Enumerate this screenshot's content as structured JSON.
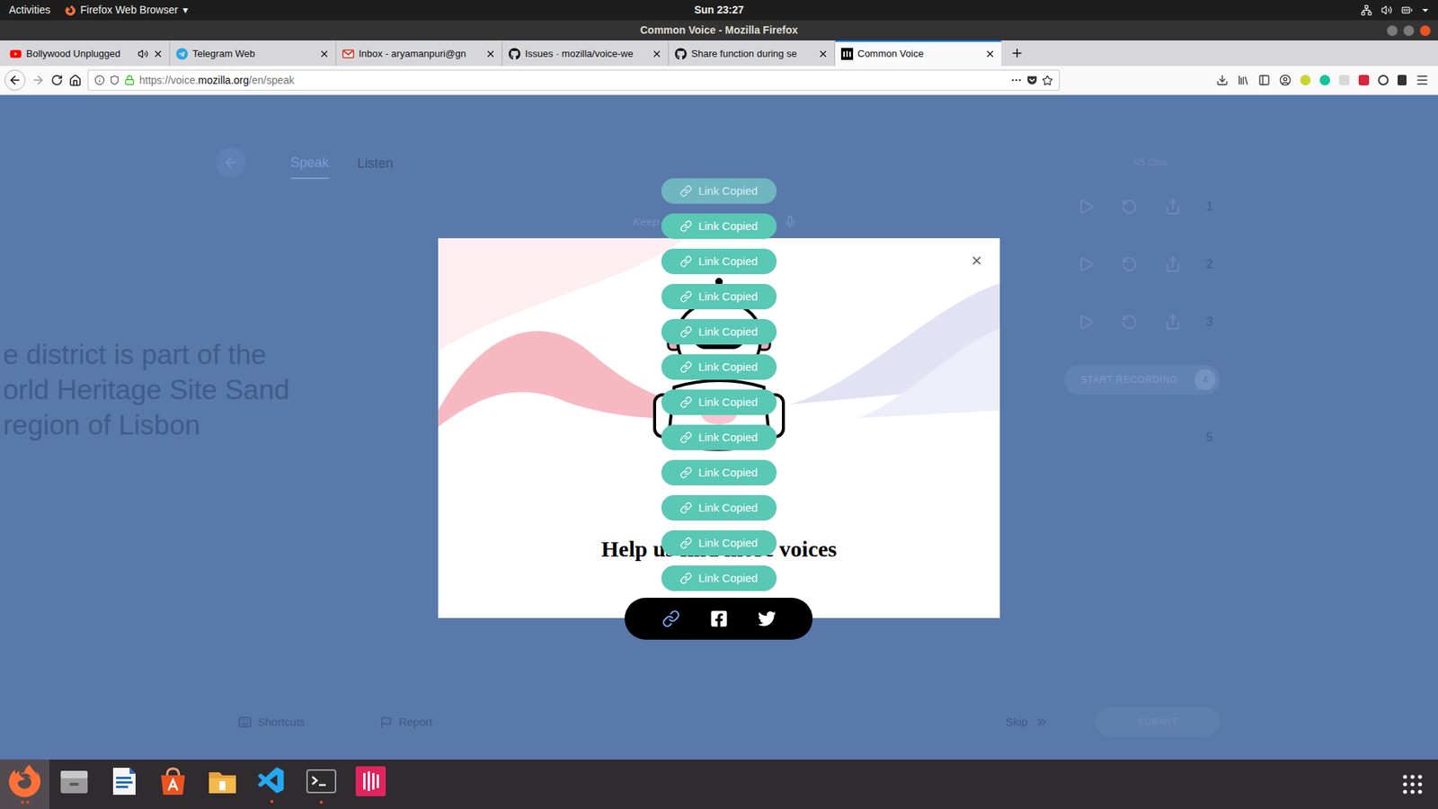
{
  "topbar": {
    "activities": "Activities",
    "app": "Firefox Web Browser",
    "app_arrow": "▾",
    "clock": "Sun 23:27"
  },
  "window": {
    "title": "Common Voice - Mozilla Firefox"
  },
  "tabs": [
    {
      "label": "Bollywood Unplugged",
      "selected": false,
      "playing_audio": true,
      "kind": "youtube"
    },
    {
      "label": "Telegram Web",
      "selected": false,
      "playing_audio": false,
      "kind": "telegram"
    },
    {
      "label": "Inbox - aryamanpuri@gn",
      "selected": false,
      "playing_audio": false,
      "kind": "gmail"
    },
    {
      "label": "Issues · mozilla/voice-we",
      "selected": false,
      "playing_audio": false,
      "kind": "github"
    },
    {
      "label": "Share function during se",
      "selected": false,
      "playing_audio": false,
      "kind": "github"
    },
    {
      "label": "Common Voice",
      "selected": true,
      "playing_audio": false,
      "kind": "commonvoice"
    }
  ],
  "address_bar": {
    "prefix": "https://voice.",
    "domain": "mozilla.org",
    "path": "/en/speak"
  },
  "page": {
    "nav": [
      {
        "label": "Speak",
        "selected": true
      },
      {
        "label": "Listen",
        "selected": false
      }
    ],
    "clips_count": "4/5 Clips",
    "hint": "Keep",
    "sentence": [
      "e district is part of the",
      "orld Heritage Site Sand",
      "region of Lisbon"
    ],
    "clips": [
      {
        "number": "1",
        "kind": "recorded",
        "button": ""
      },
      {
        "number": "2",
        "kind": "recorded",
        "button": ""
      },
      {
        "number": "3",
        "kind": "recorded",
        "button": ""
      },
      {
        "number": "4",
        "kind": "recording",
        "button": "START RECORDING"
      },
      {
        "number": "5",
        "kind": "empty",
        "button": ""
      }
    ],
    "footer": {
      "shortcuts": "Shortcuts",
      "report": "Report",
      "skip": "Skip",
      "submit": "SUBMIT"
    }
  },
  "modal": {
    "close": "×",
    "heading": "Help us find more voices"
  },
  "share_bar": {
    "buttons": [
      {
        "kind": "link",
        "highlighted": true
      },
      {
        "kind": "facebook",
        "highlighted": false
      },
      {
        "kind": "twitter",
        "highlighted": false
      }
    ]
  },
  "toasts": [
    {
      "label": "Link Copied",
      "faded": true
    },
    {
      "label": "Link Copied",
      "faded": false
    },
    {
      "label": "Link Copied",
      "faded": false
    },
    {
      "label": "Link Copied",
      "faded": false
    },
    {
      "label": "Link Copied",
      "faded": false
    },
    {
      "label": "Link Copied",
      "faded": false
    },
    {
      "label": "Link Copied",
      "faded": false
    },
    {
      "label": "Link Copied",
      "faded": false
    },
    {
      "label": "Link Copied",
      "faded": false
    },
    {
      "label": "Link Copied",
      "faded": false
    },
    {
      "label": "Link Copied",
      "faded": false
    },
    {
      "label": "Link Copied",
      "faded": false
    }
  ],
  "dock": {
    "apps": [
      {
        "kind": "firefox",
        "running": true,
        "focused": true
      },
      {
        "kind": "files",
        "running": false,
        "focused": false
      },
      {
        "kind": "writer",
        "running": false,
        "focused": false
      },
      {
        "kind": "software",
        "running": false,
        "focused": false
      },
      {
        "kind": "archive",
        "running": false,
        "focused": false
      },
      {
        "kind": "vscode",
        "running": true,
        "focused": false
      },
      {
        "kind": "terminal",
        "running": true,
        "focused": false
      },
      {
        "kind": "chat",
        "running": false,
        "focused": false
      }
    ]
  }
}
